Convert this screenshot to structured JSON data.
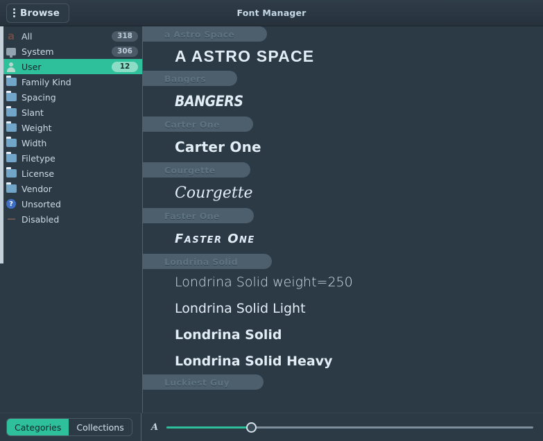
{
  "window": {
    "title": "Font Manager",
    "browse_label": "Browse",
    "browse_icon": "vertical-dots-icon"
  },
  "sidebar": {
    "items": [
      {
        "label": "All",
        "badge": "318",
        "icon": "letter-a-icon",
        "selected": false
      },
      {
        "label": "System",
        "badge": "306",
        "icon": "monitor-icon",
        "selected": false
      },
      {
        "label": "User",
        "badge": "12",
        "icon": "user-icon",
        "selected": true
      },
      {
        "label": "Family Kind",
        "badge": "",
        "icon": "folder-icon",
        "selected": false
      },
      {
        "label": "Spacing",
        "badge": "",
        "icon": "folder-icon",
        "selected": false
      },
      {
        "label": "Slant",
        "badge": "",
        "icon": "folder-icon",
        "selected": false
      },
      {
        "label": "Weight",
        "badge": "",
        "icon": "folder-icon",
        "selected": false
      },
      {
        "label": "Width",
        "badge": "",
        "icon": "folder-icon",
        "selected": false
      },
      {
        "label": "Filetype",
        "badge": "",
        "icon": "folder-icon",
        "selected": false
      },
      {
        "label": "License",
        "badge": "",
        "icon": "folder-icon",
        "selected": false
      },
      {
        "label": "Vendor",
        "badge": "",
        "icon": "folder-icon",
        "selected": false
      },
      {
        "label": "Unsorted",
        "badge": "",
        "icon": "question-icon",
        "selected": false
      },
      {
        "label": "Disabled",
        "badge": "",
        "icon": "dash-icon",
        "selected": false
      }
    ]
  },
  "fontlist": {
    "groups": [
      {
        "name": "a Astro Space",
        "samples": [
          "A ASTRO SPACE"
        ]
      },
      {
        "name": "Bangers",
        "samples": [
          "BANGERS"
        ]
      },
      {
        "name": "Carter One",
        "samples": [
          "Carter One"
        ]
      },
      {
        "name": "Courgette",
        "samples": [
          "Courgette"
        ]
      },
      {
        "name": "Faster One",
        "samples": [
          "Faster One"
        ]
      },
      {
        "name": "Londrina Solid",
        "samples": [
          "Londrina Solid weight=250",
          "Londrina Solid Light",
          "Londrina Solid",
          "Londrina Solid Heavy"
        ]
      },
      {
        "name": "Luckiest Guy",
        "samples": []
      }
    ]
  },
  "footer": {
    "tabs": [
      {
        "label": "Categories",
        "active": true
      },
      {
        "label": "Collections",
        "active": false
      }
    ],
    "size_slider": {
      "glyph": "A",
      "value_percent": 23
    }
  },
  "colors": {
    "accent": "#2ec09b",
    "background": "#2b3a45",
    "header_pill": "#4d5f6c",
    "text": "#e3edf6"
  }
}
